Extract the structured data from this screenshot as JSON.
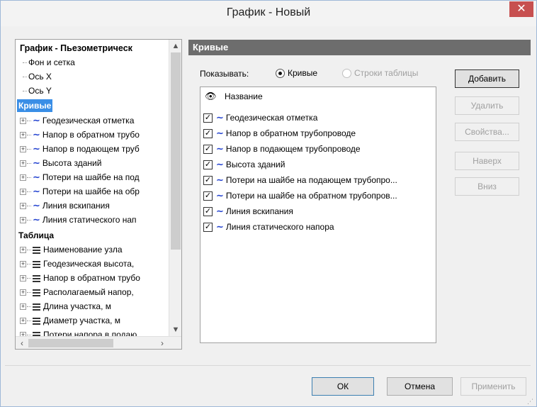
{
  "window": {
    "title": "График - Новый",
    "close_glyph": "✕"
  },
  "tree": {
    "root": "График - Пьезометрическ",
    "root_children": [
      "Фон и сетка",
      "Ось X",
      "Ось Y"
    ],
    "curves_section": "Кривые",
    "curves": [
      "Геодезическая отметка",
      "Напор в обратном трубо",
      "Напор в подающем труб",
      "Высота зданий",
      "Потери на шайбе на под",
      "Потери на шайбе на обр",
      "Линия вскипания",
      "Линия статического нап"
    ],
    "table_section": "Таблица",
    "table_items": [
      "Наименование узла",
      "Геодезическая высота,",
      "Напор в обратном трубо",
      "Располагаемый напор,",
      "Длина участка, м",
      "Диаметр участка, м",
      "Потери напора в подаю"
    ]
  },
  "panel": {
    "header": "Кривые",
    "show_label": "Показывать:",
    "radio_curves": "Кривые",
    "radio_table_rows": "Строки таблицы",
    "column_name": "Название",
    "rows": [
      {
        "label": "Геодезическая отметка",
        "checked": true
      },
      {
        "label": "Напор в обратном трубопроводе",
        "checked": true
      },
      {
        "label": "Напор в подающем трубопроводе",
        "checked": true
      },
      {
        "label": "Высота зданий",
        "checked": true
      },
      {
        "label": "Потери на шайбе на подающем трубопро...",
        "checked": true
      },
      {
        "label": "Потери на шайбе на обратном трубопров...",
        "checked": true
      },
      {
        "label": "Линия вскипания",
        "checked": true
      },
      {
        "label": "Линия статического напора",
        "checked": true
      }
    ]
  },
  "buttons": {
    "add": "Добавить",
    "delete": "Удалить",
    "properties": "Свойства...",
    "up": "Наверх",
    "down": "Вниз"
  },
  "footer": {
    "ok": "ОК",
    "cancel": "Отмена",
    "apply": "Применить"
  },
  "icons": {
    "curve": "curve-icon",
    "table": "table-lines-icon",
    "eye": "eye-icon",
    "check": "check-icon"
  },
  "colors": {
    "selection": "#3a8ee6",
    "panel_header": "#6d6d6d",
    "curve_icon": "#1f3fcf",
    "close_button": "#c75050"
  }
}
